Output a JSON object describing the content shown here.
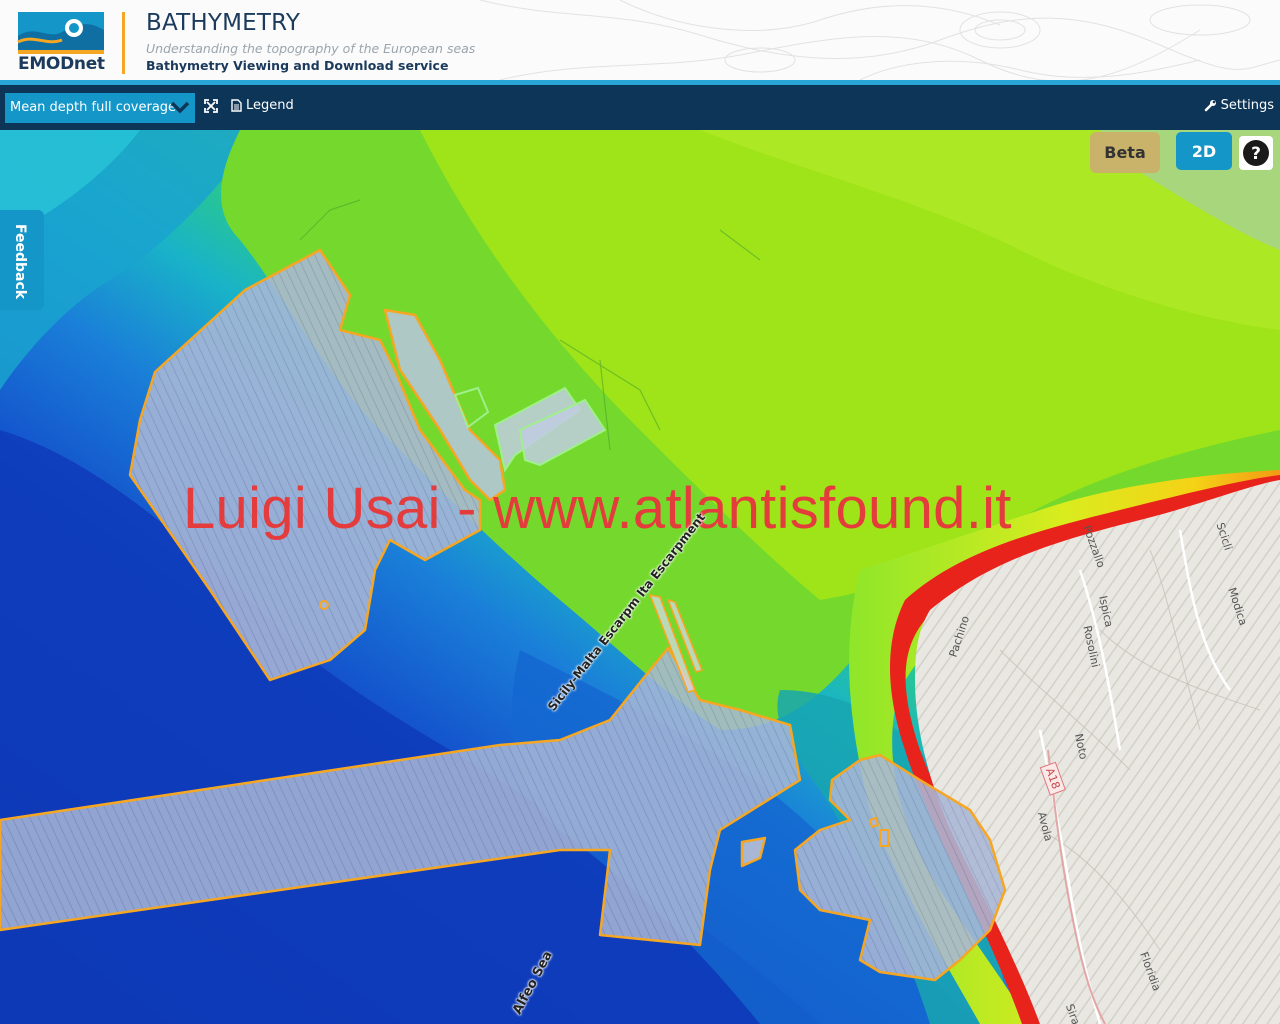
{
  "header": {
    "logo_text": "EMODnet",
    "title": "BATHYMETRY",
    "subtitle": "Understanding the topography of the European seas",
    "service": "Bathymetry Viewing and Download service"
  },
  "toolbar": {
    "layer_select": "Mean depth full coverage",
    "legend_label": "Legend",
    "settings_label": "Settings"
  },
  "map": {
    "watermark": "Luigi Usai - www.atlantisfound.it",
    "beta_label": "Beta",
    "mode_label": "2D",
    "help_label": "?",
    "feedback_label": "Feedback",
    "labels": {
      "escarpment": "Sicily-Malta Escarpm  lta Escarpment",
      "alfeo": "Alfeo Sea",
      "pachino": "Pachino",
      "ispica": "Ispica",
      "pozzallo": "Pozzallo",
      "rosolini": "Rosolini",
      "noto": "Noto",
      "avola": "Avola",
      "modica": "Modica",
      "scicli": "Scicli",
      "floridia": "Floridia",
      "siracusa": "Sira",
      "road": "A18"
    }
  }
}
